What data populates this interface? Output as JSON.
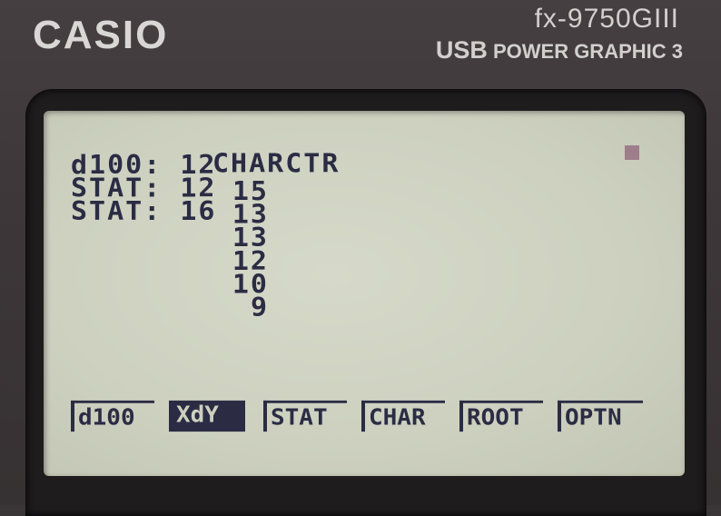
{
  "device": {
    "brand": "CASIO",
    "model": "fx-9750GIII",
    "subtitle_usb": "USB",
    "subtitle_rest": "POWER GRAPHIC 3"
  },
  "screen": {
    "left_column": [
      "d100: 12",
      "STAT: 12",
      "STAT: 16"
    ],
    "header": "CHARCTR",
    "values": [
      "15",
      "13",
      "13",
      "12",
      "10",
      "9"
    ]
  },
  "function_keys": [
    {
      "label": "d100",
      "selected": false
    },
    {
      "label": "XdY",
      "selected": true
    },
    {
      "label": "STAT",
      "selected": false
    },
    {
      "label": "CHAR",
      "selected": false
    },
    {
      "label": "ROOT",
      "selected": false
    },
    {
      "label": "OPTN",
      "selected": false
    }
  ],
  "colors": {
    "lcd_background": "#cdd0bf",
    "lcd_ink": "#2b2c44",
    "body": "#3d3739"
  }
}
